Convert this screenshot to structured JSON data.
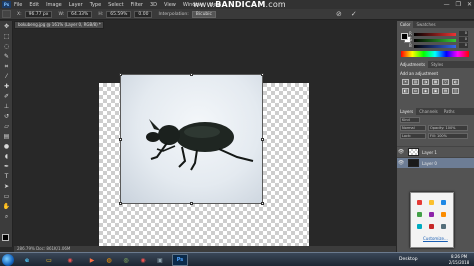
{
  "app": {
    "logo": "Ps"
  },
  "menu": [
    "File",
    "Edit",
    "Image",
    "Layer",
    "Type",
    "Select",
    "Filter",
    "3D",
    "View",
    "Window",
    "Help"
  ],
  "watermark": {
    "url": "www.",
    "brand": "BANDICAM",
    "suffix": ".com"
  },
  "window_controls": {
    "minimize": "—",
    "maximize": "❐",
    "close": "✕"
  },
  "options_bar": {
    "x_label": "X:",
    "x_value": "96.77 px",
    "w_label": "W:",
    "w_value": "64.33%",
    "h_label": "H:",
    "h_value": "65.59%",
    "angle_value": "0.00",
    "interpolation_label": "Interpolation:",
    "interpolation_value": "Bicubic"
  },
  "commit_icons": {
    "cancel": "⊘",
    "commit": "✓"
  },
  "document_tab": "bokubeng.jpg @ 161% (Layer 0, RGB/8) *",
  "status_bar": "286.79%    Doc: 861K/1.06M",
  "color_panel": {
    "tabs": [
      "Color",
      "Swatches"
    ],
    "sliders": [
      {
        "letter": "R",
        "value": "0",
        "color": "#e33"
      },
      {
        "letter": "G",
        "value": "0",
        "color": "#3c3"
      },
      {
        "letter": "B",
        "value": "0",
        "color": "#36e"
      }
    ]
  },
  "adjustments_panel": {
    "tabs": [
      "Adjustments",
      "Styles"
    ],
    "title": "Add an adjustment",
    "icons_row1": [
      "☀",
      "▥",
      "◑",
      "▦",
      "▽",
      "◐"
    ],
    "icons_row2": [
      "◧",
      "⚖",
      "◉",
      "▣",
      "▤",
      "◫"
    ]
  },
  "layers_panel": {
    "tabs": [
      "Layers",
      "Channels",
      "Paths"
    ],
    "kind_label": "Kind",
    "blend_mode": "Normal",
    "opacity_label": "Opacity: 100%",
    "lock_label": "Lock:",
    "fill_label": "Fill: 100%",
    "layers": [
      {
        "name": "Layer 1",
        "visible": "👁",
        "selected": false
      },
      {
        "name": "Layer 0",
        "visible": "👁",
        "selected": true
      }
    ]
  },
  "tray_popup": {
    "customize": "Customize...",
    "icon_colors": [
      "#e53935",
      "#fbc02d",
      "#1e88e5",
      "#43a047",
      "#8e24aa",
      "#fb8c00",
      "#00acc1",
      "#c62828",
      "#546e7a"
    ]
  },
  "taskbar": {
    "apps": [
      {
        "name": "ie",
        "glyph": "e",
        "color": "#4fc3f7"
      },
      {
        "name": "explorer",
        "glyph": "▭",
        "color": "#ffca28"
      },
      {
        "name": "chrome",
        "glyph": "◉",
        "color": "#ef5350"
      },
      {
        "name": "media",
        "glyph": "▶",
        "color": "#ff7043"
      },
      {
        "name": "firefox",
        "glyph": "◍",
        "color": "#ff9800"
      },
      {
        "name": "bandicam",
        "glyph": "◎",
        "color": "#9ccc65"
      },
      {
        "name": "chrome2",
        "glyph": "◉",
        "color": "#ef5350"
      },
      {
        "name": "camera",
        "glyph": "▣",
        "color": "#90a4ae"
      },
      {
        "name": "photoshop",
        "glyph": "Ps",
        "color": "#4fa3ff"
      }
    ],
    "desktop_label": "Desktop",
    "time": "8:26 PM",
    "date": "2/15/2018"
  }
}
